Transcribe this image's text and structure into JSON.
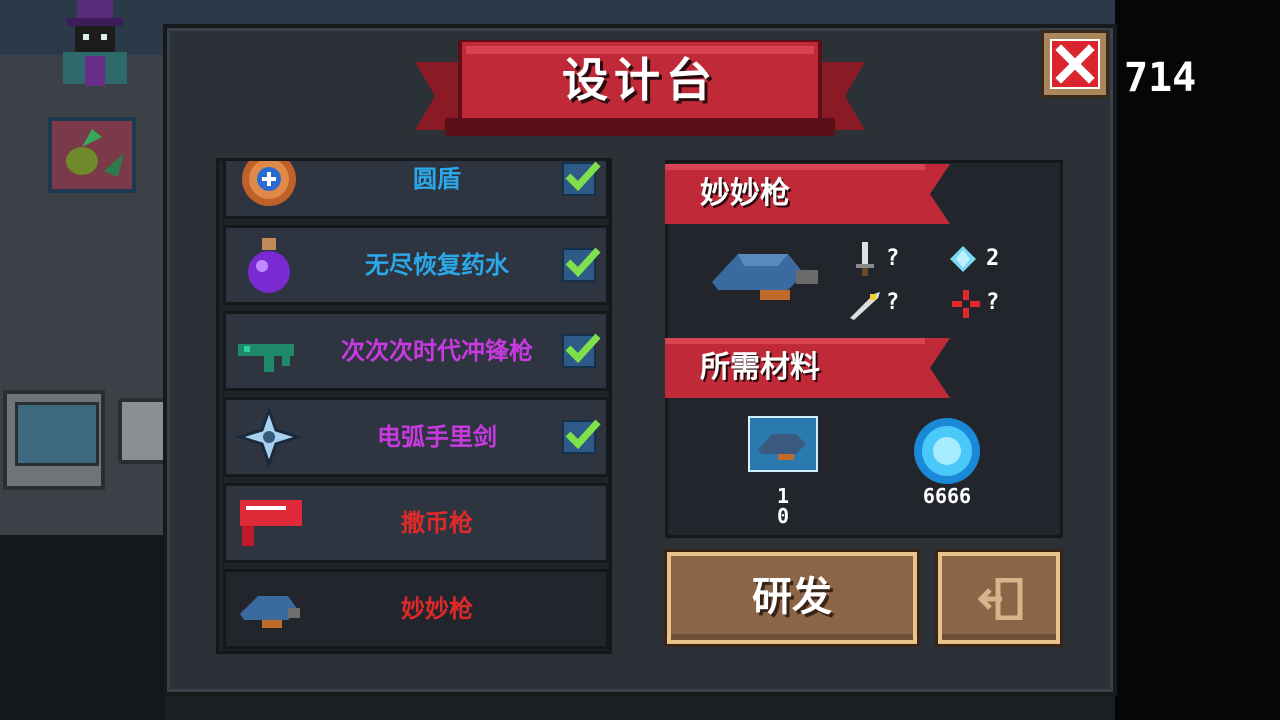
{
  "title": "设计台",
  "counter": "714",
  "close_label": "X",
  "list": [
    {
      "name": "圆盾",
      "color": "#2aa8e8",
      "checked": true,
      "icon": "round-shield-icon"
    },
    {
      "name": "无尽恢复药水",
      "color": "#2aa8e8",
      "checked": true,
      "icon": "purple-potion-icon"
    },
    {
      "name": "次次次时代冲锋枪",
      "color": "#c63ae0",
      "checked": true,
      "icon": "smg-icon"
    },
    {
      "name": "电弧手里剑",
      "color": "#c63ae0",
      "checked": true,
      "icon": "shuriken-icon"
    },
    {
      "name": "撒币枪",
      "color": "#e02a2a",
      "checked": false,
      "icon": "coin-gun-icon"
    },
    {
      "name": "妙妙枪",
      "color": "#e02a2a",
      "checked": false,
      "icon": "miaomiao-gun-icon"
    }
  ],
  "detail": {
    "weapon_name": "妙妙枪",
    "stats": {
      "damage": "?",
      "energy": "2",
      "crit": "?",
      "accuracy": "?"
    },
    "materials_title": "所需材料",
    "materials": [
      {
        "icon": "blueprint-icon",
        "have": "1",
        "need": "0"
      },
      {
        "icon": "gem-orb-icon",
        "count": "6666"
      }
    ]
  },
  "buttons": {
    "research": "研发",
    "exit_icon": "exit-door-icon"
  }
}
